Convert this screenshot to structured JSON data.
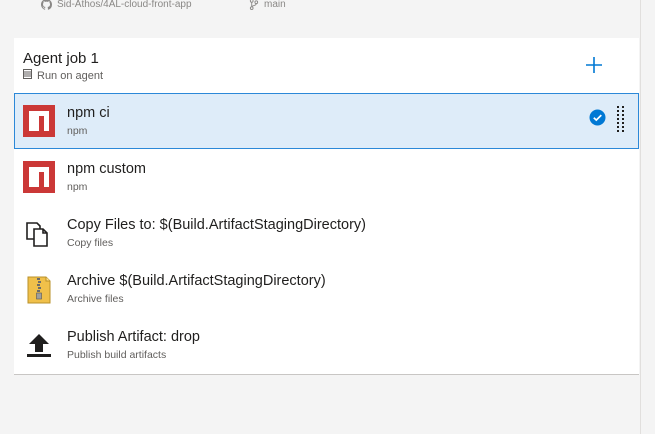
{
  "topbar": {
    "repo": "Sid-Athos/4AL-cloud-front-app",
    "branch": "main",
    "repo_icon": "github-icon",
    "branch_icon": "branch-icon"
  },
  "job": {
    "title": "Agent job 1",
    "subtitle": "Run on agent",
    "add_icon": "plus-icon"
  },
  "tasks": [
    {
      "name": "npm ci",
      "type": "npm",
      "icon": "npm-icon",
      "selected": true
    },
    {
      "name": "npm custom",
      "type": "npm",
      "icon": "npm-icon",
      "selected": false
    },
    {
      "name": "Copy Files to: $(Build.ArtifactStagingDirectory)",
      "type": "Copy files",
      "icon": "copy-files-icon",
      "selected": false
    },
    {
      "name": "Archive $(Build.ArtifactStagingDirectory)",
      "type": "Archive files",
      "icon": "archive-icon",
      "selected": false
    },
    {
      "name": "Publish Artifact: drop",
      "type": "Publish build artifacts",
      "icon": "upload-icon",
      "selected": false
    }
  ],
  "colors": {
    "accent": "#0078d4",
    "selected_bg": "#deecf9",
    "npm_red": "#cb3837"
  }
}
